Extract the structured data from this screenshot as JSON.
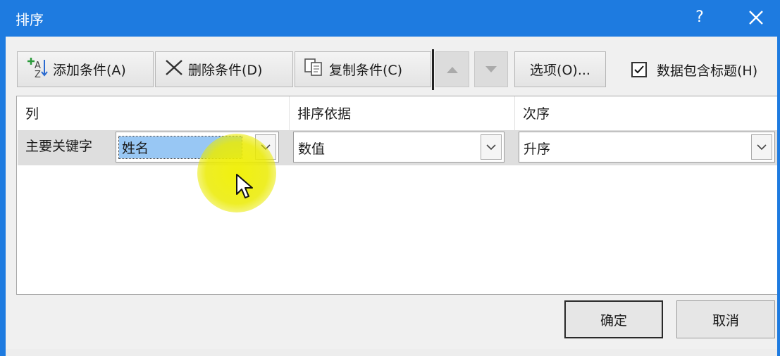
{
  "title": "排序",
  "title_buttons": {
    "help": "?",
    "close": "✕"
  },
  "toolbar": {
    "add_label": "添加条件(A)",
    "delete_label": "删除条件(D)",
    "copy_label": "复制条件(C)",
    "move_up_icon": "arrow-up-icon",
    "move_down_icon": "arrow-down-icon",
    "options_label": "选项(O)...",
    "has_headers_label": "数据包含标题(H)",
    "has_headers_checked": true
  },
  "grid": {
    "headers": {
      "column": "列",
      "sort_on": "排序依据",
      "order": "次序"
    },
    "rows": [
      {
        "label": "主要关键字",
        "column": "姓名",
        "sort_on": "数值",
        "order": "升序"
      }
    ]
  },
  "buttons": {
    "ok": "确定",
    "cancel": "取消"
  },
  "colors": {
    "title_bar": "#1e7be0",
    "selection": "#98c7f4",
    "cursor_highlight": "#f0f000"
  }
}
